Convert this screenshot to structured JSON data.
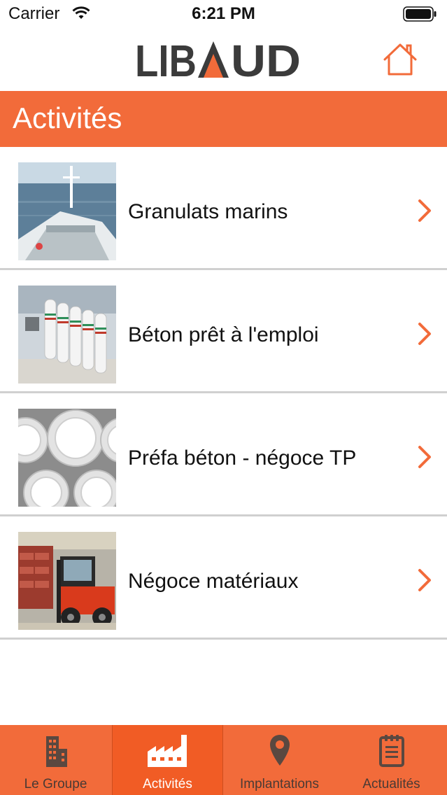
{
  "status": {
    "carrier": "Carrier",
    "time": "6:21 PM"
  },
  "header": {
    "logo_text": "LIBAUD"
  },
  "section": {
    "title": "Activités"
  },
  "colors": {
    "accent": "#f26b3a",
    "active_tab": "#f15c25",
    "inactive_icon": "#5a4840"
  },
  "activities": [
    {
      "label": "Granulats marins",
      "image": "ship-photo"
    },
    {
      "label": "Béton prêt à l'emploi",
      "image": "concrete-silo-photo"
    },
    {
      "label": "Préfa béton - négoce TP",
      "image": "concrete-pipes-photo"
    },
    {
      "label": "Négoce matériaux",
      "image": "forklift-photo"
    }
  ],
  "tabs": [
    {
      "label": "Le Groupe",
      "icon": "building-icon",
      "active": false
    },
    {
      "label": "Activités",
      "icon": "factory-icon",
      "active": true
    },
    {
      "label": "Implantations",
      "icon": "map-pin-icon",
      "active": false
    },
    {
      "label": "Actualités",
      "icon": "notepad-icon",
      "active": false
    }
  ]
}
